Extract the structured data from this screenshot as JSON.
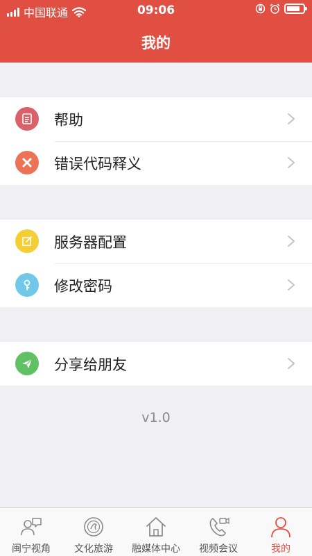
{
  "status_bar": {
    "carrier": "中国联通",
    "time": "09:06"
  },
  "header": {
    "title": "我的"
  },
  "menu": {
    "help": {
      "label": "帮助",
      "icon": "document-icon",
      "color": "#d9626a"
    },
    "error_codes": {
      "label": "错误代码释义",
      "icon": "close-icon",
      "color": "#ec7356"
    },
    "server_config": {
      "label": "服务器配置",
      "icon": "edit-icon",
      "color": "#f3cf35"
    },
    "change_password": {
      "label": "修改密码",
      "icon": "key-icon",
      "color": "#6fc8e8"
    },
    "share": {
      "label": "分享给朋友",
      "icon": "paper-plane-icon",
      "color": "#5fc064"
    }
  },
  "version": "v1.0",
  "tabbar": {
    "tabs": [
      {
        "label": "闽宁视角",
        "icon": "people-chat-icon"
      },
      {
        "label": "文化旅游",
        "icon": "culture-icon"
      },
      {
        "label": "融媒体中心",
        "icon": "home-icon"
      },
      {
        "label": "视频会议",
        "icon": "video-call-icon"
      },
      {
        "label": "我的",
        "icon": "person-icon",
        "active": true
      }
    ],
    "active_color": "#e04f42"
  },
  "colors": {
    "header": "#e04f42",
    "background": "#efeff4"
  }
}
